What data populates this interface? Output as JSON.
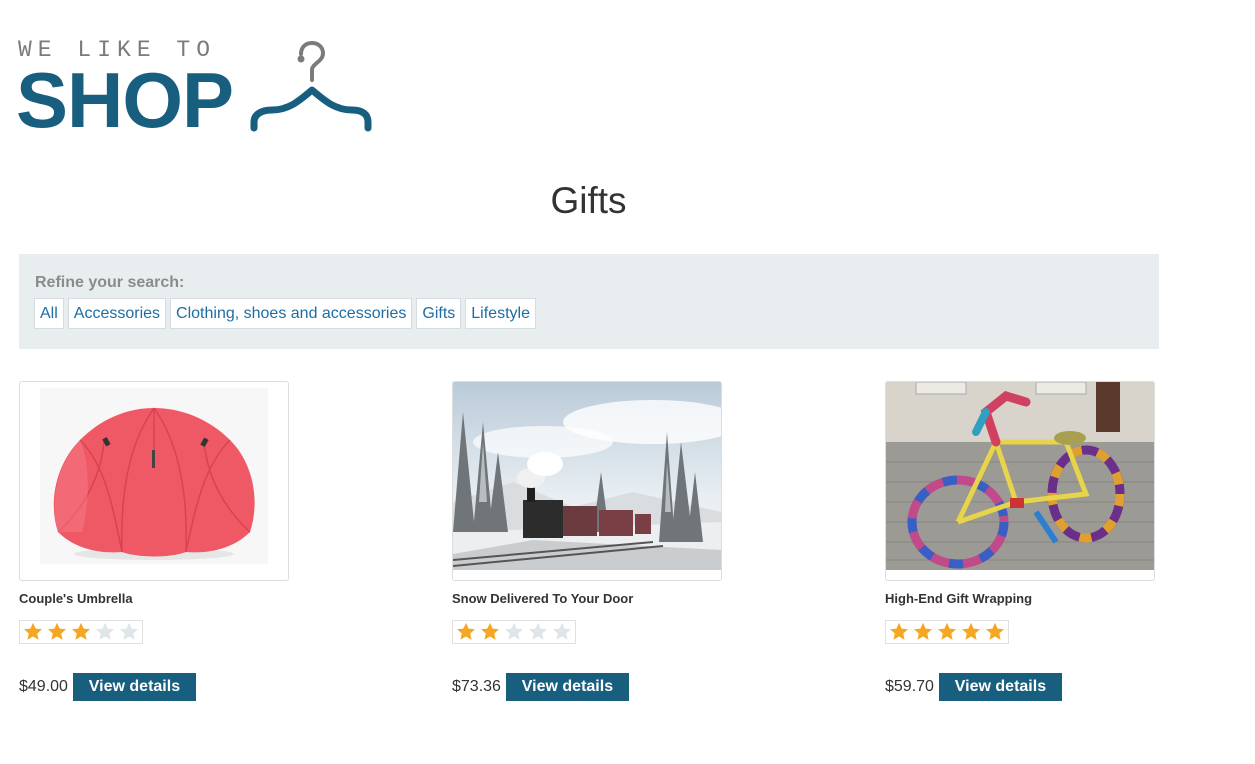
{
  "logo": {
    "tagline": "WE LIKE TO",
    "word": "SHOP"
  },
  "page_title": "Gifts",
  "refine": {
    "label": "Refine your search:",
    "filters": [
      "All",
      "Accessories",
      "Clothing, shoes and accessories",
      "Gifts",
      "Lifestyle"
    ]
  },
  "products": [
    {
      "name": "Couple's Umbrella",
      "rating": 3,
      "max_rating": 5,
      "price": "$49.00",
      "button": "View details",
      "image": "red-umbrella"
    },
    {
      "name": "Snow Delivered To Your Door",
      "rating": 2,
      "max_rating": 5,
      "price": "$73.36",
      "button": "View details",
      "image": "steam-train-snow"
    },
    {
      "name": "High-End Gift Wrapping",
      "rating": 5,
      "max_rating": 5,
      "price": "$59.70",
      "button": "View details",
      "image": "knitted-bicycle"
    }
  ],
  "colors": {
    "brand": "#175e7f",
    "link": "#1c6ea4",
    "star_filled": "#f5a623",
    "star_empty": "#dfe6e9",
    "refine_bg": "#e8eef0"
  }
}
